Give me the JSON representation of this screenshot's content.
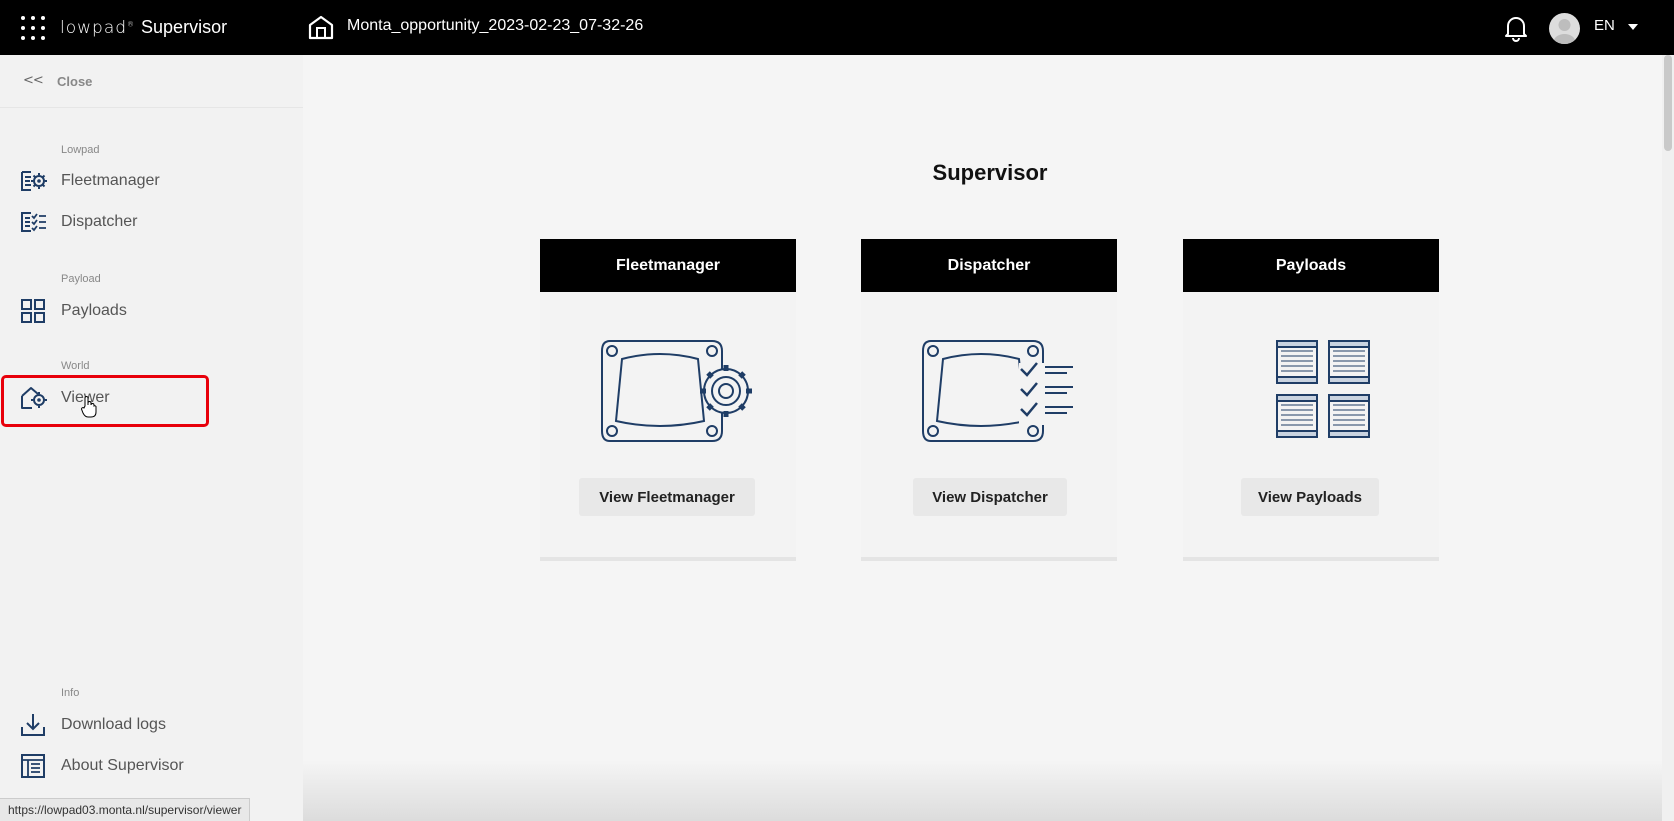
{
  "topbar": {
    "brand_logo": "lowpad",
    "brand_mark": "®",
    "brand_name": "Supervisor",
    "project_title": "Monta_opportunity_2023-02-23_07-32-26",
    "language": "EN"
  },
  "sidebar": {
    "close_label": "Close",
    "sections": [
      {
        "label": "Lowpad",
        "items": [
          {
            "label": "Fleetmanager",
            "icon": "fleetmanager-icon"
          },
          {
            "label": "Dispatcher",
            "icon": "dispatcher-icon"
          }
        ]
      },
      {
        "label": "Payload",
        "items": [
          {
            "label": "Payloads",
            "icon": "grid-icon"
          }
        ]
      },
      {
        "label": "World",
        "items": [
          {
            "label": "Viewer",
            "icon": "viewer-icon"
          }
        ]
      },
      {
        "label": "Info",
        "items": [
          {
            "label": "Download logs",
            "icon": "download-icon"
          },
          {
            "label": "About Supervisor",
            "icon": "window-icon"
          }
        ]
      }
    ]
  },
  "main": {
    "title": "Supervisor",
    "cards": [
      {
        "title": "Fleetmanager",
        "button": "View Fleetmanager",
        "illustration": "robot-gear-illustration"
      },
      {
        "title": "Dispatcher",
        "button": "View Dispatcher",
        "illustration": "robot-checklist-illustration"
      },
      {
        "title": "Payloads",
        "button": "View Payloads",
        "illustration": "payload-grid-illustration"
      }
    ]
  },
  "statusbar": {
    "url": "https://lowpad03.monta.nl/supervisor/viewer"
  },
  "colors": {
    "topbar": "#000000",
    "icon_blue": "#1f3d66",
    "highlight": "#e8000b"
  }
}
